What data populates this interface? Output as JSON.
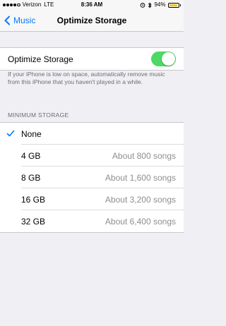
{
  "status_bar": {
    "carrier": "Verizon",
    "network": "LTE",
    "time": "8:36 AM",
    "battery_percent": "94%",
    "battery_level": 0.94,
    "signal_bars": 4
  },
  "nav": {
    "back_label": "Music",
    "title": "Optimize Storage"
  },
  "toggle_section": {
    "label": "Optimize Storage",
    "enabled": true,
    "footnote": "If your iPhone is low on space, automatically remove music from this iPhone that you haven't played in a while."
  },
  "min_storage": {
    "header": "MINIMUM STORAGE",
    "options": [
      {
        "label": "None",
        "detail": "",
        "selected": true
      },
      {
        "label": "4 GB",
        "detail": "About 800 songs",
        "selected": false
      },
      {
        "label": "8 GB",
        "detail": "About 1,600 songs",
        "selected": false
      },
      {
        "label": "16 GB",
        "detail": "About 3,200 songs",
        "selected": false
      },
      {
        "label": "32 GB",
        "detail": "About 6,400 songs",
        "selected": false
      }
    ]
  },
  "colors": {
    "accent": "#007aff",
    "toggle_on": "#4cd964",
    "battery": "#f5c518",
    "background": "#efeff4"
  }
}
